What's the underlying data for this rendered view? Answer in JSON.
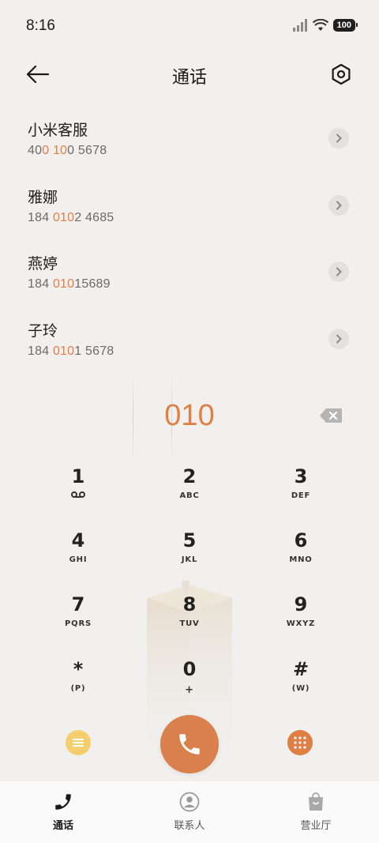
{
  "status_bar": {
    "time": "8:16",
    "battery": "100"
  },
  "header": {
    "title": "通话"
  },
  "contacts": [
    {
      "name": "小米客服",
      "number_parts": [
        "40",
        "0 10",
        "0 5678"
      ]
    },
    {
      "name": "雅娜",
      "number_parts": [
        "184 ",
        "010",
        "2 4685"
      ]
    },
    {
      "name": "燕婷",
      "number_parts": [
        "184 ",
        "010",
        "15689"
      ]
    },
    {
      "name": "子玲",
      "number_parts": [
        "184 ",
        "010",
        "1 5678"
      ]
    }
  ],
  "dialer": {
    "entered": "010",
    "keys": [
      {
        "digit": "1",
        "letters": ""
      },
      {
        "digit": "2",
        "letters": "ABC"
      },
      {
        "digit": "3",
        "letters": "DEF"
      },
      {
        "digit": "4",
        "letters": "GHI"
      },
      {
        "digit": "5",
        "letters": "JKL"
      },
      {
        "digit": "6",
        "letters": "MNO"
      },
      {
        "digit": "7",
        "letters": "PQRS"
      },
      {
        "digit": "8",
        "letters": "TUV"
      },
      {
        "digit": "9",
        "letters": "WXYZ"
      },
      {
        "digit": "*",
        "letters": "(P)"
      },
      {
        "digit": "0",
        "letters": "+"
      },
      {
        "digit": "#",
        "letters": "(W)"
      }
    ]
  },
  "tabs": [
    {
      "label": "通话",
      "icon": "phone-icon",
      "active": true
    },
    {
      "label": "联系人",
      "icon": "person-icon",
      "active": false
    },
    {
      "label": "营业厅",
      "icon": "shopping-bag-icon",
      "active": false
    }
  ],
  "colors": {
    "accent": "#e07f44",
    "call_button": "#d9804c",
    "menu_button": "#f5cf6e"
  }
}
